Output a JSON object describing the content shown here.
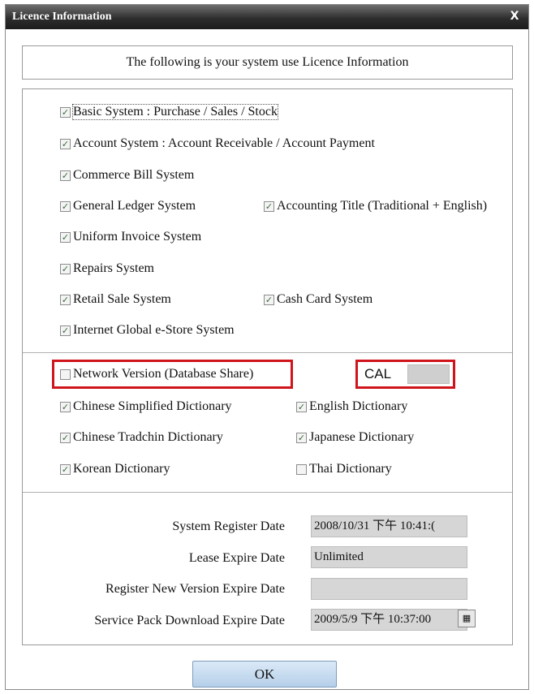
{
  "window": {
    "title": "Licence Information",
    "close_label": "X"
  },
  "header": {
    "text": "The following is your system use Licence Information"
  },
  "modules": [
    {
      "label": "Basic System : Purchase / Sales / Stock",
      "checked": true
    },
    {
      "label": "Account System : Account Receivable / Account Payment",
      "checked": true
    },
    {
      "label": "Commerce Bill System",
      "checked": true
    },
    {
      "label": "General Ledger System",
      "checked": true
    },
    {
      "label": "Accounting Title (Traditional + English)",
      "checked": true
    },
    {
      "label": "Uniform Invoice System",
      "checked": true
    },
    {
      "label": "Repairs System",
      "checked": true
    },
    {
      "label": "Retail Sale System",
      "checked": true
    },
    {
      "label": "Cash Card System",
      "checked": true
    },
    {
      "label": "Internet Global e-Store System",
      "checked": true
    }
  ],
  "network": {
    "label": "Network Version (Database Share)",
    "checked": false,
    "cal_label": "CAL",
    "cal_value": ""
  },
  "dictionaries": [
    {
      "label": "Chinese Simplified Dictionary",
      "checked": true
    },
    {
      "label": "English Dictionary",
      "checked": true
    },
    {
      "label": "Chinese Tradchin Dictionary",
      "checked": true
    },
    {
      "label": "Japanese Dictionary",
      "checked": true
    },
    {
      "label": "Korean Dictionary",
      "checked": true
    },
    {
      "label": "Thai Dictionary",
      "checked": false
    }
  ],
  "dates": [
    {
      "label": "System Register Date",
      "value": "2008/10/31 下午 10:41:("
    },
    {
      "label": "Lease Expire Date",
      "value": "Unlimited"
    },
    {
      "label": "Register New Version Expire Date",
      "value": ""
    },
    {
      "label": "Service Pack Download Expire Date",
      "value": "2009/5/9 下午 10:37:00"
    }
  ],
  "ok_button": {
    "label": "OK"
  },
  "colors": {
    "highlight": "#d0141c",
    "titlebar": "#2e2e2e",
    "field_bg": "#d6d6d6"
  }
}
